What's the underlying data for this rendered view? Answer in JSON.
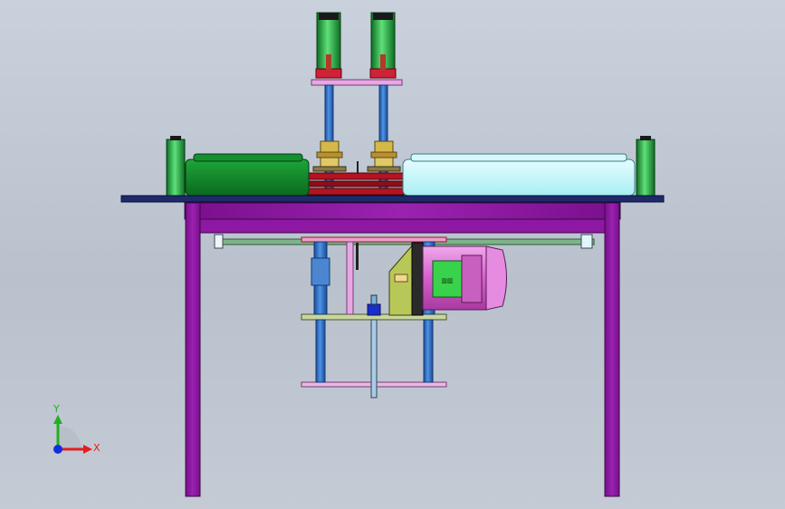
{
  "viewport": {
    "background_top": "#c9d1dc",
    "background_bottom": "#c4cbd5"
  },
  "colors": {
    "frame": "#8a149e",
    "frame_edge": "#3a0a45",
    "base_plate": "#1f2a6b",
    "green_cover": "#118a2a",
    "cyan_cover": "#c8f5f8",
    "shaft_blue": "#2a6fc8",
    "motor_pink": "#e07ad8",
    "motor_green": "#38d34a",
    "cylinder_green": "#2ecc52",
    "red_bar": "#a8141e",
    "brass": "#c8a43a"
  },
  "triad": {
    "x_label": "X",
    "y_label": "Y",
    "x_color": "#e02020",
    "y_color": "#20b020",
    "z_color": "#1030e0"
  }
}
